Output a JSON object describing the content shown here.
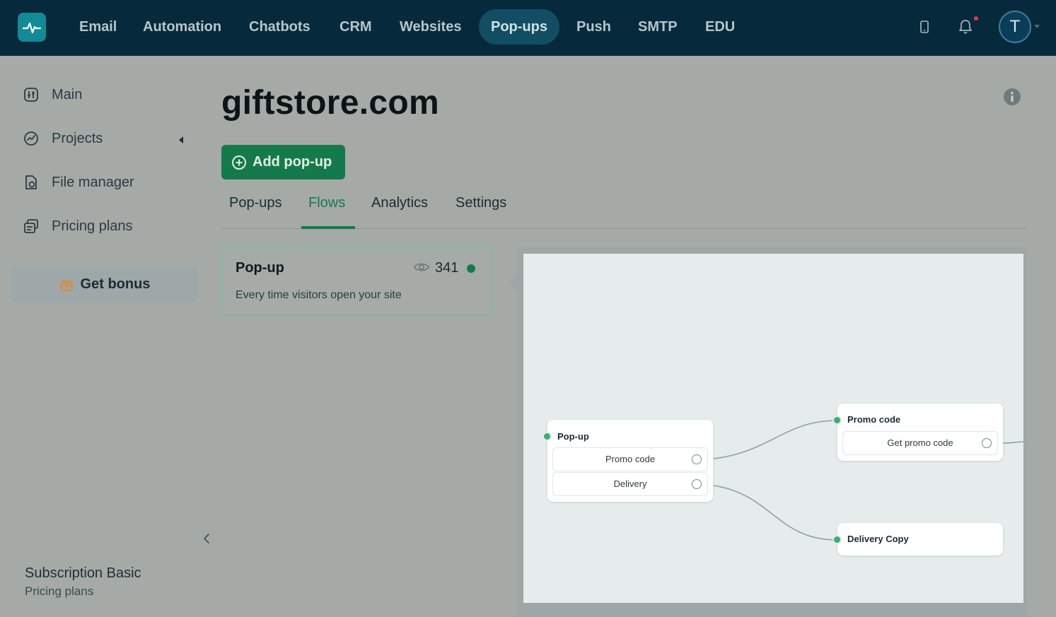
{
  "nav": {
    "items": [
      {
        "label": "Email",
        "active": false
      },
      {
        "label": "Automation",
        "active": false
      },
      {
        "label": "Chatbots",
        "active": false
      },
      {
        "label": "CRM",
        "active": false
      },
      {
        "label": "Websites",
        "active": false
      },
      {
        "label": "Pop-ups",
        "active": true
      },
      {
        "label": "Push",
        "active": false
      },
      {
        "label": "SMTP",
        "active": false
      },
      {
        "label": "EDU",
        "active": false
      }
    ],
    "avatar_initial": "T",
    "has_notification": true
  },
  "sidebar": {
    "items": [
      {
        "label": "Main",
        "icon": "dashboard-icon"
      },
      {
        "label": "Projects",
        "icon": "projects-icon"
      },
      {
        "label": "File manager",
        "icon": "file-manager-icon"
      },
      {
        "label": "Pricing plans",
        "icon": "pricing-icon"
      }
    ],
    "bonus_label": "Get bonus",
    "subscription": {
      "title": "Subscription Basic",
      "link": "Pricing plans"
    }
  },
  "page": {
    "title": "giftstore.com",
    "add_button": "Add pop-up",
    "tabs": [
      {
        "label": "Pop-ups",
        "active": false
      },
      {
        "label": "Flows",
        "active": true
      },
      {
        "label": "Analytics",
        "active": false
      },
      {
        "label": "Settings",
        "active": false
      }
    ]
  },
  "flow_card": {
    "title": "Pop-up",
    "views": "341",
    "description": "Every time visitors open your site",
    "status": "active"
  },
  "flow_nodes": {
    "popup": {
      "title": "Pop-up",
      "options": [
        "Promo code",
        "Delivery"
      ]
    },
    "promo": {
      "title": "Promo code",
      "options": [
        "Get promo code"
      ]
    },
    "delivery": {
      "title": "Delivery Copy"
    }
  },
  "colors": {
    "brand_green": "#157a4b",
    "nav_bg": "#062a3b",
    "port_green": "#3aae73",
    "connector": "#8aa3ad"
  }
}
